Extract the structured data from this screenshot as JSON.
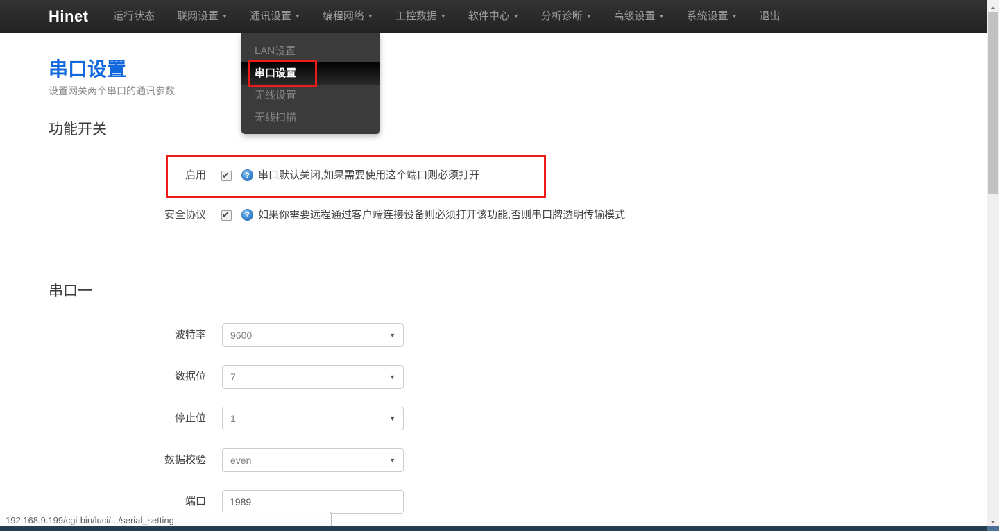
{
  "icons": {
    "caret_down": "▼",
    "select_arrow": "▼",
    "check": "✔",
    "help": "?",
    "scroll_up": "▲",
    "scroll_down": "▼"
  },
  "colors": {
    "accent_blue": "#1268dd",
    "annotation_red": "#ed1c1c",
    "navbar_bg": "#222222",
    "dropdown_bg": "#3b3b3b"
  },
  "navbar": {
    "brand": "Hinet",
    "items": [
      {
        "label": "运行状态",
        "caret": false
      },
      {
        "label": "联网设置",
        "caret": true
      },
      {
        "label": "通讯设置",
        "caret": true
      },
      {
        "label": "编程网络",
        "caret": true
      },
      {
        "label": "工控数据",
        "caret": true
      },
      {
        "label": "软件中心",
        "caret": true
      },
      {
        "label": "分析诊断",
        "caret": true
      },
      {
        "label": "高级设置",
        "caret": true
      },
      {
        "label": "系统设置",
        "caret": true
      },
      {
        "label": "退出",
        "caret": false
      }
    ]
  },
  "dropdown": {
    "parent": "通讯设置",
    "items": [
      {
        "label": "LAN设置",
        "active": false
      },
      {
        "label": "串口设置",
        "active": true
      },
      {
        "label": "无线设置",
        "active": false
      },
      {
        "label": "无线扫描",
        "active": false
      }
    ]
  },
  "page": {
    "title": "串口设置",
    "subtitle": "设置网关两个串口的通讯参数"
  },
  "function_switch": {
    "heading": "功能开关",
    "rows": [
      {
        "label": "启用",
        "checked": true,
        "help": "串口默认关闭,如果需要使用这个端口则必须打开"
      },
      {
        "label": "安全协议",
        "checked": true,
        "help": "如果你需要远程通过客户端连接设备则必须打开该功能,否则串口牌透明传输模式"
      }
    ]
  },
  "serial_port_one": {
    "heading": "串口一",
    "fields": [
      {
        "label": "波特率",
        "value": "9600",
        "control": "select"
      },
      {
        "label": "数据位",
        "value": "7",
        "control": "select"
      },
      {
        "label": "停止位",
        "value": "1",
        "control": "select"
      },
      {
        "label": "数据校验",
        "value": "even",
        "control": "select"
      },
      {
        "label": "端口",
        "value": "1989",
        "control": "text"
      }
    ]
  },
  "status_bar": {
    "link_preview": "192.168.9.199/cgi-bin/luci/.../serial_setting"
  }
}
